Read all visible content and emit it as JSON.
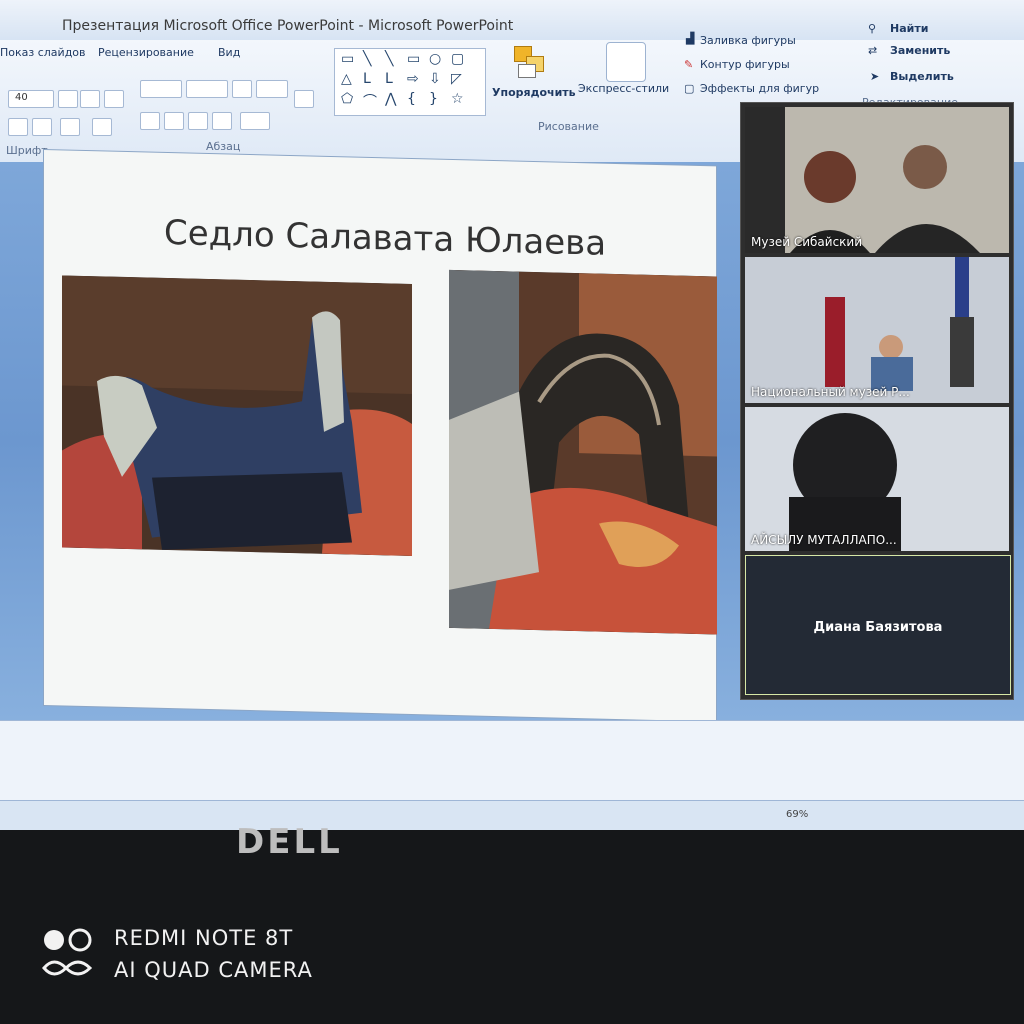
{
  "window": {
    "title": "Презентация Microsoft Office PowerPoint - Microsoft PowerPoint"
  },
  "ribbon": {
    "tabs": [
      "Показ слайдов",
      "Рецензирование",
      "Вид"
    ],
    "font_size": "40",
    "groups": {
      "font_label": "Шрифт",
      "paragraph_label": "Абзац",
      "drawing_label": "Рисование"
    },
    "buttons": {
      "arrange": "Упорядочить",
      "quick_styles": "Экспресс-стили",
      "shape_fill": "Заливка фигуры",
      "shape_outline": "Контур фигуры",
      "shape_effects": "Эффекты для фигур",
      "find": "Найти",
      "replace": "Заменить",
      "select": "Выделить",
      "editing": "Редактирование"
    }
  },
  "slide": {
    "title": "Седло Салавата Юлаева"
  },
  "status": {
    "zoom": "69%"
  },
  "conference": {
    "participants": [
      {
        "name": "Музей Сибайский"
      },
      {
        "name": "Национальный музей Р..."
      },
      {
        "name": "АЙСЫЛУ МУТАЛЛАПО..."
      },
      {
        "name": "Диана Баязитова"
      }
    ]
  },
  "laptop": {
    "brand": "DELL"
  },
  "watermark": {
    "line1": "REDMI NOTE 8T",
    "line2": "AI QUAD CAMERA"
  }
}
